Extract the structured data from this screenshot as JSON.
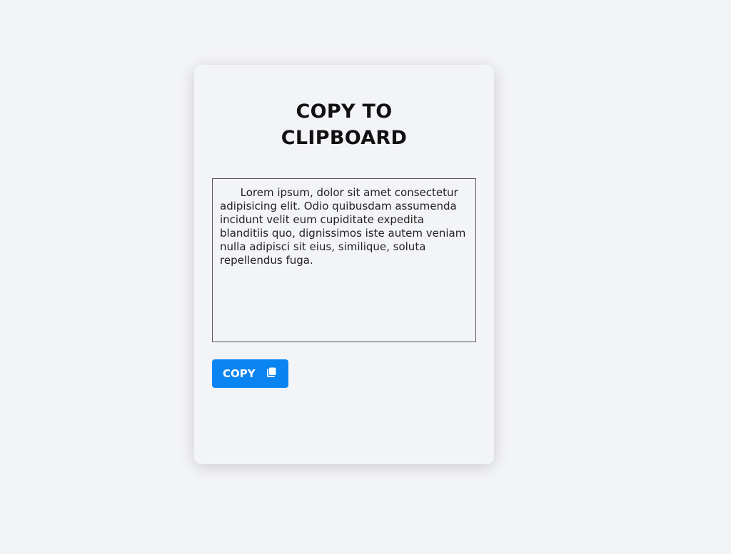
{
  "card": {
    "title_line1": "COPY TO",
    "title_line2": "CLIPBOARD",
    "text_content": "      Lorem ipsum, dolor sit amet consectetur adipisicing elit. Odio quibusdam assumenda incidunt velit eum cupiditate expedita blanditiis quo, dignissimos iste autem veniam nulla adipisci sit eius, similique, soluta repellendus fuga.",
    "copy_label": "COPY",
    "copy_icon": "copy-icon"
  },
  "colors": {
    "background": "#f3f4f8",
    "button": "#0a84f0",
    "title": "#111111"
  }
}
